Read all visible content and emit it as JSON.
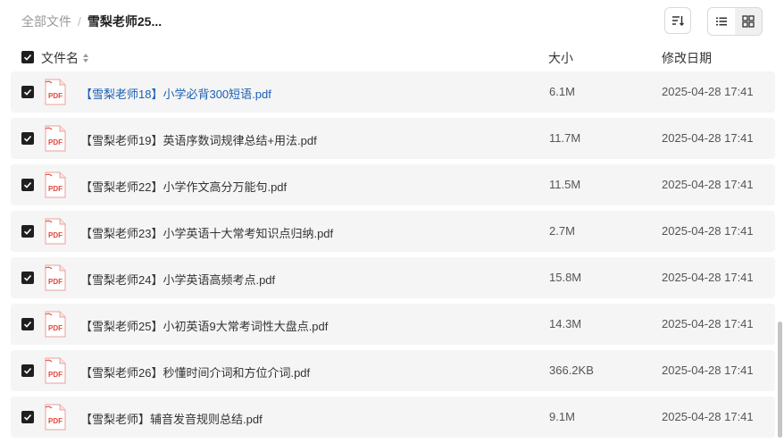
{
  "breadcrumb": {
    "root": "全部文件",
    "separator": "/",
    "current": "雪梨老师25..."
  },
  "toolbar": {
    "sort_icon": "sort-icon",
    "list_view_icon": "list-view-icon",
    "grid_view_icon": "grid-view-icon",
    "active_view": "list"
  },
  "columns": {
    "name": "文件名",
    "size": "大小",
    "date": "修改日期"
  },
  "colors": {
    "checkbox": "#1f1f1f",
    "row_bg": "#f5f5f5",
    "link": "#1a5fb4",
    "pdf": "#e0473c"
  },
  "files": [
    {
      "name": "【雪梨老师18】小学必背300短语.pdf",
      "size": "6.1M",
      "date": "2025-04-28 17:41",
      "icon": "pdf-file-icon"
    },
    {
      "name": "【雪梨老师19】英语序数词规律总结+用法.pdf",
      "size": "11.7M",
      "date": "2025-04-28 17:41",
      "icon": "pdf-file-icon"
    },
    {
      "name": "【雪梨老师22】小学作文高分万能句.pdf",
      "size": "11.5M",
      "date": "2025-04-28 17:41",
      "icon": "pdf-file-icon"
    },
    {
      "name": "【雪梨老师23】小学英语十大常考知识点归纳.pdf",
      "size": "2.7M",
      "date": "2025-04-28 17:41",
      "icon": "pdf-file-icon"
    },
    {
      "name": "【雪梨老师24】小学英语高频考点.pdf",
      "size": "15.8M",
      "date": "2025-04-28 17:41",
      "icon": "pdf-file-icon"
    },
    {
      "name": "【雪梨老师25】小初英语9大常考词性大盘点.pdf",
      "size": "14.3M",
      "date": "2025-04-28 17:41",
      "icon": "pdf-file-icon"
    },
    {
      "name": "【雪梨老师26】秒懂时间介词和方位介词.pdf",
      "size": "366.2KB",
      "date": "2025-04-28 17:41",
      "icon": "pdf-file-icon"
    },
    {
      "name": "【雪梨老师】辅音发音规则总结.pdf",
      "size": "9.1M",
      "date": "2025-04-28 17:41",
      "icon": "pdf-file-icon"
    }
  ]
}
